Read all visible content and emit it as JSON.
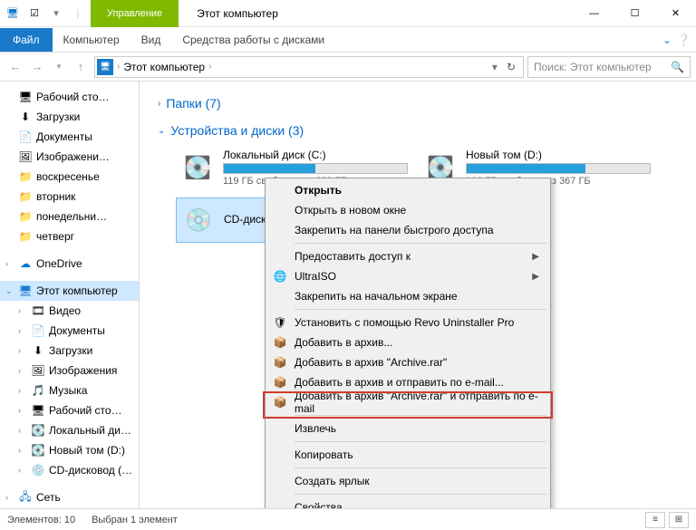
{
  "window": {
    "contextual_tab": "Управление",
    "title": "Этот компьютер"
  },
  "ribbon": {
    "file": "Файл",
    "tabs": [
      "Компьютер",
      "Вид",
      "Средства работы с дисками"
    ]
  },
  "address": {
    "root": "Этот компьютер"
  },
  "search": {
    "placeholder": "Поиск: Этот компьютер"
  },
  "sidebar": {
    "quick": [
      {
        "label": "Рабочий сто…",
        "icon": "🖥"
      },
      {
        "label": "Загрузки",
        "icon": "⬇"
      },
      {
        "label": "Документы",
        "icon": "📄"
      },
      {
        "label": "Изображени…",
        "icon": "🖼"
      },
      {
        "label": "воскресенье",
        "icon": "📁"
      },
      {
        "label": "вторник",
        "icon": "📁"
      },
      {
        "label": "понедельни…",
        "icon": "📁"
      },
      {
        "label": "четверг",
        "icon": "📁"
      }
    ],
    "onedrive": "OneDrive",
    "thispc": "Этот компьютер",
    "thispc_items": [
      {
        "label": "Видео",
        "icon": "🎞"
      },
      {
        "label": "Документы",
        "icon": "📄"
      },
      {
        "label": "Загрузки",
        "icon": "⬇"
      },
      {
        "label": "Изображения",
        "icon": "🖼"
      },
      {
        "label": "Музыка",
        "icon": "🎵"
      },
      {
        "label": "Рабочий сто…",
        "icon": "🖥"
      },
      {
        "label": "Локальный ди…",
        "icon": "💽"
      },
      {
        "label": "Новый том (D:)",
        "icon": "💽"
      },
      {
        "label": "CD-дисковод (…",
        "icon": "💿"
      }
    ],
    "network": "Сеть"
  },
  "content": {
    "group_folders": "Папки (7)",
    "group_devices": "Устройства и диски (3)",
    "drives": [
      {
        "name": "Локальный диск (C:)",
        "fill": 50,
        "free": "119 ГБ свободно из 232 ГБ",
        "icon": "💽"
      },
      {
        "name": "Новый том (D:)",
        "fill": 65,
        "free": "126 ГБ свободно из 367 ГБ",
        "icon": "💽"
      },
      {
        "name": "CD-дисковод (E:)",
        "fill": null,
        "free": "",
        "icon": "💿",
        "selected": true
      }
    ]
  },
  "context_menu": [
    {
      "type": "item",
      "label": "Открыть",
      "bold": true
    },
    {
      "type": "item",
      "label": "Открыть в новом окне"
    },
    {
      "type": "item",
      "label": "Закрепить на панели быстрого доступа"
    },
    {
      "type": "sep"
    },
    {
      "type": "item",
      "label": "Предоставить доступ к",
      "submenu": true
    },
    {
      "type": "item",
      "label": "UltraISO",
      "icon": "🌐",
      "submenu": true
    },
    {
      "type": "item",
      "label": "Закрепить на начальном экране"
    },
    {
      "type": "sep"
    },
    {
      "type": "item",
      "label": "Установить с помощью Revo Uninstaller Pro",
      "icon": "🛡"
    },
    {
      "type": "item",
      "label": "Добавить в архив...",
      "icon": "📦"
    },
    {
      "type": "item",
      "label": "Добавить в архив \"Archive.rar\"",
      "icon": "📦"
    },
    {
      "type": "item",
      "label": "Добавить в архив и отправить по e-mail...",
      "icon": "📦"
    },
    {
      "type": "item",
      "label": "Добавить в архив \"Archive.rar\" и отправить по e-mail",
      "icon": "📦"
    },
    {
      "type": "sep"
    },
    {
      "type": "item",
      "label": "Извлечь",
      "highlight": true
    },
    {
      "type": "sep"
    },
    {
      "type": "item",
      "label": "Копировать"
    },
    {
      "type": "sep"
    },
    {
      "type": "item",
      "label": "Создать ярлык"
    },
    {
      "type": "sep"
    },
    {
      "type": "item",
      "label": "Свойства"
    }
  ],
  "status": {
    "elements": "Элементов: 10",
    "selected": "Выбран 1 элемент"
  }
}
